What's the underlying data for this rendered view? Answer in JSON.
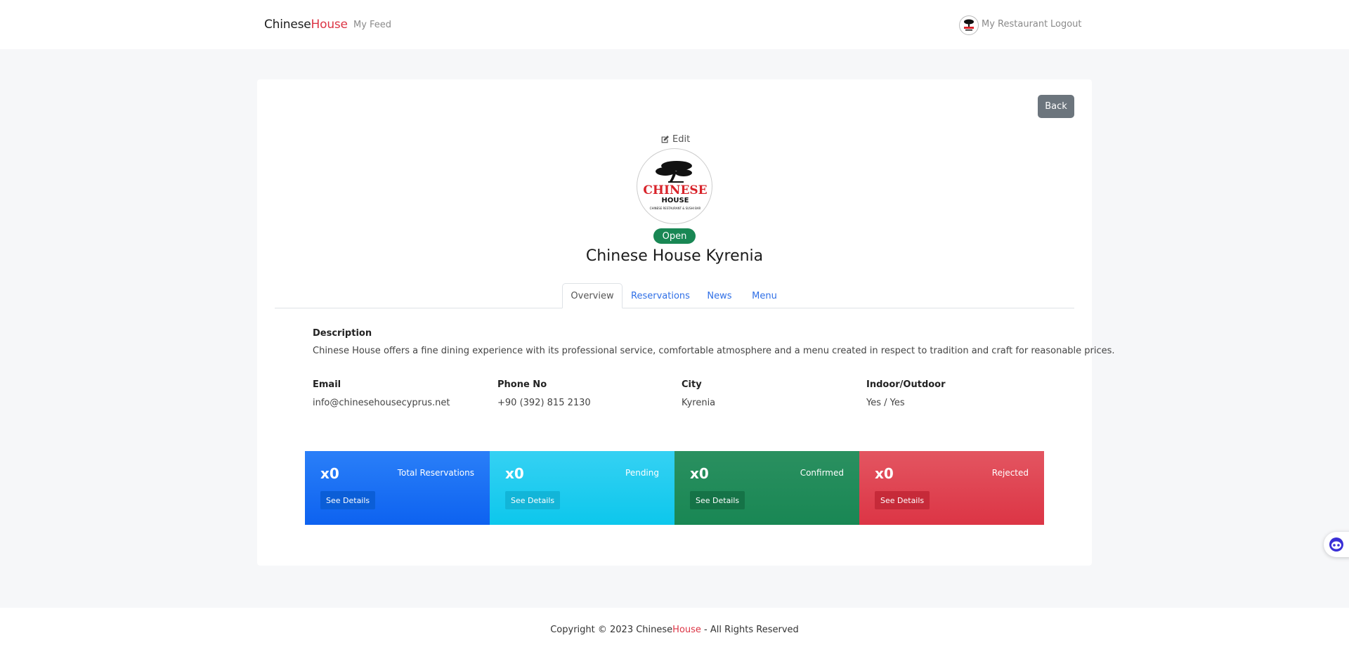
{
  "nav": {
    "brand_main": "Chinese",
    "brand_accent": "House",
    "feed_label": "My Feed",
    "my_restaurant_label": "My Restaurant",
    "logout_label": "Logout"
  },
  "restaurant": {
    "back_label": "Back",
    "edit_label": "Edit",
    "status": "Open",
    "name": "Chinese House Kyrenia",
    "logo": {
      "title": "CHINESE",
      "subtitle": "HOUSE",
      "tagline": "CHINESE RESTAURANT & SUSHI BAR"
    }
  },
  "tabs": [
    {
      "label": "Overview",
      "active": true
    },
    {
      "label": "Reservations",
      "active": false
    },
    {
      "label": "News",
      "active": false
    },
    {
      "label": "Menu",
      "active": false
    }
  ],
  "overview": {
    "description_label": "Description",
    "description": "Chinese House offers a fine dining experience with its professional service, comfortable atmosphere and a menu created in respect to tradition and craft for reasonable prices.",
    "fields": [
      {
        "label": "Email",
        "value": "info@chinesehousecyprus.net"
      },
      {
        "label": "Phone No",
        "value": "+90 (392) 815 2130"
      },
      {
        "label": "City",
        "value": "Kyrenia"
      },
      {
        "label": "Indoor/Outdoor",
        "value": "Yes / Yes"
      }
    ]
  },
  "stats": [
    {
      "count": "x0",
      "label": "Total Reservations",
      "button": "See Details",
      "color": "#0d6efd"
    },
    {
      "count": "x0",
      "label": "Pending",
      "button": "See Details",
      "color": "#0dcaf0"
    },
    {
      "count": "x0",
      "label": "Confirmed",
      "button": "See Details",
      "color": "#198754"
    },
    {
      "count": "x0",
      "label": "Rejected",
      "button": "See Details",
      "color": "#dc3545"
    }
  ],
  "footer": {
    "prefix": "Copyright © 2023 Chinese",
    "accent": "House",
    "suffix": " - All Rights Reserved"
  },
  "colors": {
    "brand_accent": "#dc3545",
    "link": "#2f6fe6",
    "status_open": "#198754",
    "back_button": "#6c757d"
  }
}
